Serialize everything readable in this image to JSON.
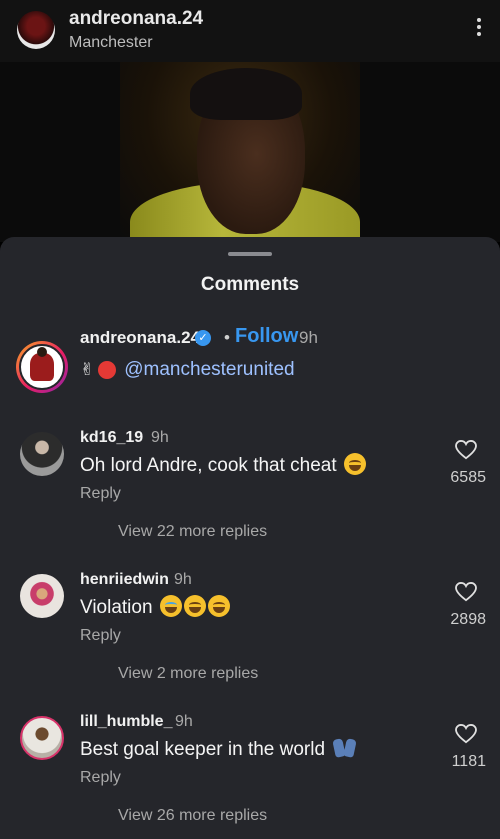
{
  "post_header": {
    "username": "andreonana.24",
    "location": "Manchester"
  },
  "sheet": {
    "title": "Comments"
  },
  "caption": {
    "username": "andreonana.24",
    "separator": "•",
    "follow_label": "Follow",
    "time": "9h",
    "mention": "@manchesterunited"
  },
  "comments": [
    {
      "username": "kd16_19",
      "time": "9h",
      "text": "Oh lord Andre, cook that cheat",
      "reply_label": "Reply",
      "view_replies": "View 22 more replies",
      "likes": "6585"
    },
    {
      "username": "henriiedwin",
      "time": "9h",
      "text": "Violation",
      "reply_label": "Reply",
      "view_replies": "View 2 more replies",
      "likes": "2898"
    },
    {
      "username": "lill_humble_",
      "time": "9h",
      "text": "Best goal keeper in the world",
      "reply_label": "Reply",
      "view_replies": "View 26 more replies",
      "likes": "1181"
    }
  ],
  "colors": {
    "sheet_bg": "#25262b",
    "accent": "#3897f0",
    "mention": "#9ec1ff"
  },
  "icons": [
    "more-vert-icon",
    "verified-badge-icon",
    "heart-icon"
  ]
}
